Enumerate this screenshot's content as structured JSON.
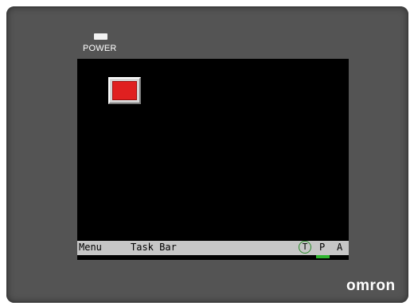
{
  "device": {
    "power_label": "POWER",
    "brand_logo": "omron"
  },
  "screen": {
    "red_button_color": "#e02020",
    "background_color": "#000000"
  },
  "taskbar": {
    "menu_label": "Menu",
    "title_label": "Task Bar",
    "t_label": "T",
    "p_label": "P",
    "a_label": "A",
    "status_color": "#2fb52f"
  }
}
